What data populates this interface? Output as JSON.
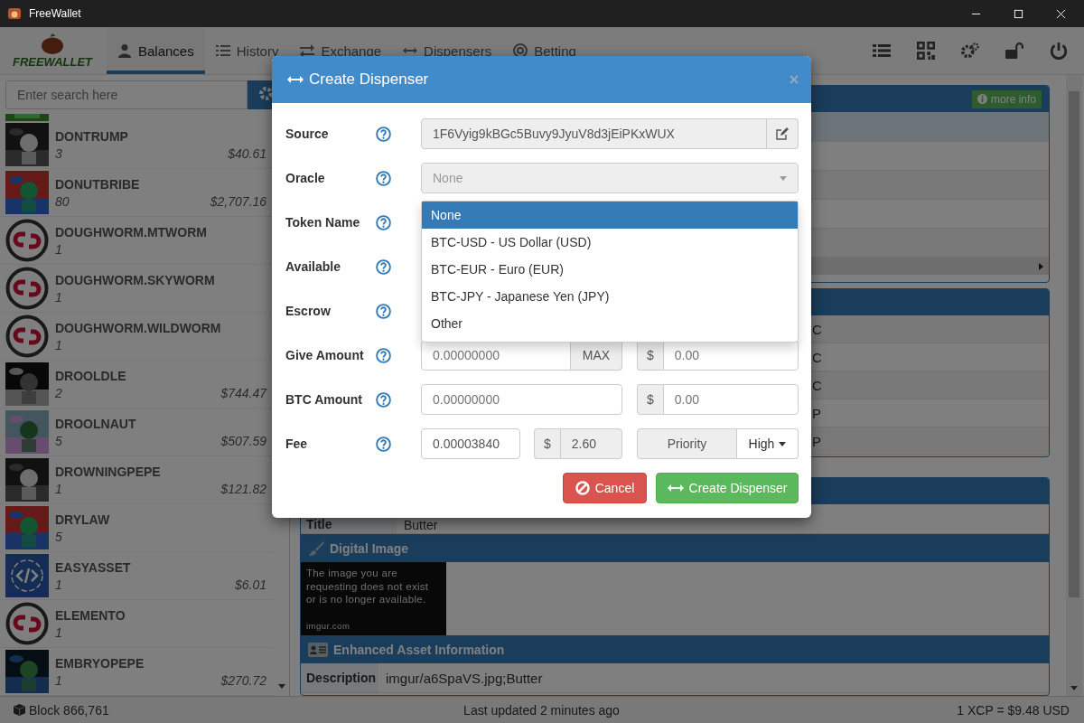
{
  "window": {
    "title": "FreeWallet"
  },
  "logo": {
    "text": "FREEWALLET"
  },
  "tabs": [
    {
      "label": "Balances",
      "selected": true
    },
    {
      "label": "History",
      "selected": false
    },
    {
      "label": "Exchange",
      "selected": false
    },
    {
      "label": "Dispensers",
      "selected": false
    },
    {
      "label": "Betting",
      "selected": false
    }
  ],
  "search": {
    "placeholder": "Enter search here"
  },
  "assets": [
    {
      "name": "DONTRUMP",
      "amount": "3",
      "value": "$40.61",
      "kind": "picture"
    },
    {
      "name": "DONUTBRIBE",
      "amount": "80",
      "value": "$2,707.16",
      "kind": "picture"
    },
    {
      "name": "DOUGHWORM.MTWORM",
      "amount": "1",
      "kind": "link"
    },
    {
      "name": "DOUGHWORM.SKYWORM",
      "amount": "1",
      "kind": "link"
    },
    {
      "name": "DOUGHWORM.WILDWORM",
      "amount": "1",
      "kind": "link"
    },
    {
      "name": "DROOLDLE",
      "amount": "2",
      "value": "$744.47",
      "kind": "picture"
    },
    {
      "name": "DROOLNAUT",
      "amount": "5",
      "value": "$507.59",
      "kind": "picture"
    },
    {
      "name": "DROWNINGPEPE",
      "amount": "1",
      "value": "$121.82",
      "kind": "picture"
    },
    {
      "name": "DRYLAW",
      "amount": "5",
      "kind": "picture"
    },
    {
      "name": "EASYASSET",
      "amount": "1",
      "value": "$6.01",
      "kind": "code"
    },
    {
      "name": "ELEMENTO",
      "amount": "1",
      "kind": "link"
    },
    {
      "name": "EMBRYOPEPE",
      "amount": "1",
      "value": "$270.72",
      "kind": "picture"
    }
  ],
  "info_panel": {
    "badge": "more info"
  },
  "balances_panel": {
    "cells": [
      "C",
      "C",
      "C",
      "P",
      "P"
    ]
  },
  "details_panel": {
    "rows": [
      {
        "label": "Title",
        "value": "Butter"
      }
    ]
  },
  "digital_image": {
    "heading": "Digital Image",
    "notice": "The image you are requesting does not exist or is no longer available.",
    "source": "imgur.com"
  },
  "enhanced_info": {
    "heading": "Enhanced Asset Information",
    "rows": [
      {
        "label": "Description",
        "value": "imgur/a6SpaVS.jpg;Butter"
      }
    ]
  },
  "status_bar": {
    "block": "Block 866,761",
    "updated": "Last updated 2 minutes ago",
    "rate": "1 XCP = $9.48 USD"
  },
  "modal": {
    "title": "Create Dispenser",
    "source": {
      "label": "Source",
      "value": "1F6Vyig9kBGc5Buvy9JyuV8d3jEiPKxWUX"
    },
    "oracle": {
      "label": "Oracle",
      "placeholder": "None",
      "options": [
        {
          "label": "None",
          "selected": true
        },
        {
          "label": "BTC-USD - US Dollar (USD)",
          "selected": false
        },
        {
          "label": "BTC-EUR - Euro (EUR)",
          "selected": false
        },
        {
          "label": "BTC-JPY - Japanese Yen (JPY)",
          "selected": false
        },
        {
          "label": "Other",
          "selected": false
        }
      ]
    },
    "hidden_rows": [
      {
        "label": "Token Name"
      },
      {
        "label": "Available"
      },
      {
        "label": "Escrow"
      }
    ],
    "give": {
      "label": "Give Amount",
      "placeholder": "0.00000000",
      "max": "MAX",
      "currency": "$",
      "usd_placeholder": "0.00"
    },
    "btc": {
      "label": "BTC Amount",
      "placeholder": "0.00000000",
      "currency": "$",
      "usd_placeholder": "0.00"
    },
    "fee": {
      "label": "Fee",
      "value": "0.00003840",
      "currency": "$",
      "usd": "2.60",
      "priority_label": "Priority",
      "priority": "High"
    },
    "cancel": "Cancel",
    "submit": "Create Dispenser"
  }
}
